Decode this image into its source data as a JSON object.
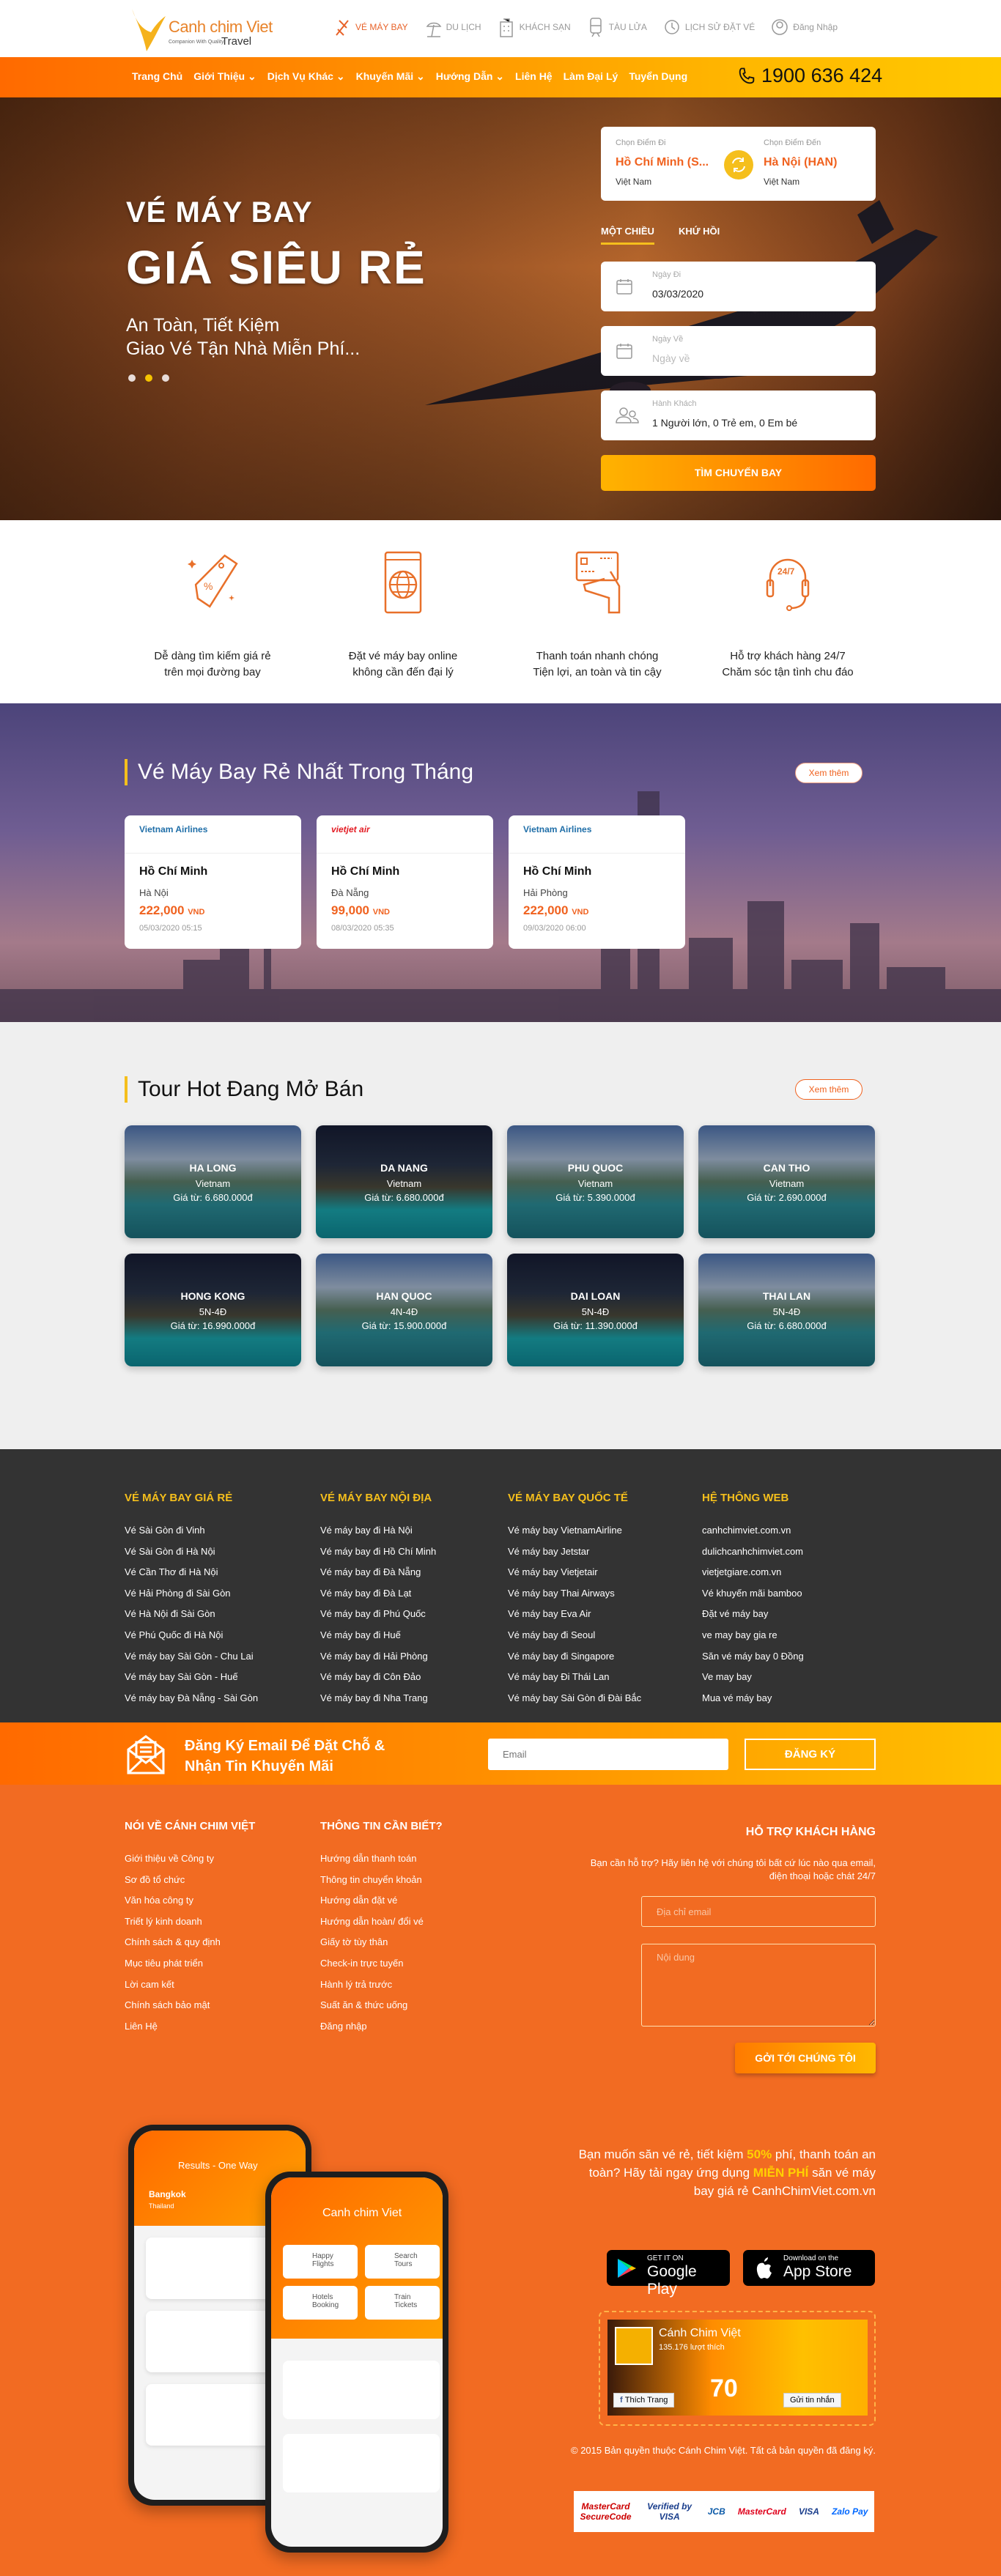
{
  "colors": {
    "accent": "#f0621f",
    "yellow": "#f5bf1c",
    "dark_footer": "#333333",
    "orange_footer": "#f26b22"
  },
  "header": {
    "logo": {
      "brand": "Canh chim Viet",
      "tagline": "Companion With Quality",
      "travel": "Travel"
    },
    "topnav": [
      {
        "label": "VÉ MÁY BAY",
        "icon": "plane-icon",
        "active": true
      },
      {
        "label": "DU LỊCH",
        "icon": "beach-umbrella-icon"
      },
      {
        "label": "KHÁCH SẠN",
        "icon": "hotel-icon"
      },
      {
        "label": "TÀU LỬA",
        "icon": "train-icon"
      },
      {
        "label": "LỊCH SỬ ĐẶT VÉ",
        "icon": "history-icon"
      },
      {
        "label": "Đăng Nhập",
        "icon": "user-icon"
      }
    ]
  },
  "nav": {
    "items": [
      {
        "label": "Trang Chủ"
      },
      {
        "label": "Giới Thiệu ⌄"
      },
      {
        "label": "Dịch Vụ Khác ⌄"
      },
      {
        "label": "Khuyến Mãi ⌄"
      },
      {
        "label": "Hướng Dẫn ⌄"
      },
      {
        "label": "Liên Hệ"
      },
      {
        "label": "Làm Đại Lý"
      },
      {
        "label": "Tuyển Dụng"
      }
    ],
    "hotline": "1900 636 424"
  },
  "hero": {
    "line1": "VÉ MÁY BAY",
    "line2": "GIÁ SIÊU RẺ",
    "sub1": "An Toàn, Tiết Kiệm",
    "sub2": "Giao Vé Tận Nhà Miễn Phí...",
    "slides": 3,
    "active_slide": 2
  },
  "search": {
    "from_label": "Chọn Điểm Đi",
    "from_city": "Hồ Chí Minh (S...",
    "from_country": "Việt Nam",
    "to_label": "Chọn Điểm Đến",
    "to_city": "Hà Nội (HAN)",
    "to_country": "Việt Nam",
    "tab_oneway": "MỘT CHIỀU",
    "tab_return": "KHỨ HỒI",
    "depart_label": "Ngày Đi",
    "depart_value": "03/03/2020",
    "return_label": "Ngày Về",
    "return_placeholder": "Ngày về",
    "pax_label": "Hành Khách",
    "pax_value": "1 Người lớn, 0 Trẻ em, 0 Em bé",
    "submit": "TÌM CHUYẾN BAY"
  },
  "features": [
    {
      "icon": "price-tag-icon",
      "l1": "Dễ dàng tìm kiếm giá rẻ",
      "l2": "trên mọi đường bay"
    },
    {
      "icon": "globe-browser-icon",
      "l1": "Đặt vé máy bay online",
      "l2": "không cần đến đại lý"
    },
    {
      "icon": "card-payment-icon",
      "l1": "Thanh toán nhanh chóng",
      "l2": "Tiện lợi, an toàn và tin cậy"
    },
    {
      "icon": "headset-247-icon",
      "l1": "Hỗ trợ khách hàng 24/7",
      "l2": "Chăm sóc tận tình chu đáo",
      "badge": "24/7"
    }
  ],
  "cheap": {
    "title": "Vé Máy Bay Rẻ Nhất Trong Tháng",
    "more": "Xem thêm",
    "flights": [
      {
        "airline": "Vietnam Airlines",
        "from": "Hồ Chí Minh",
        "to": "Hà Nội",
        "price": "222,000",
        "currency": "VND",
        "date": "05/03/2020 05:15"
      },
      {
        "airline": "vietjet air",
        "from": "Hồ Chí Minh",
        "to": "Đà Nẵng",
        "price": "99,000",
        "currency": "VND",
        "date": "08/03/2020 05:35"
      },
      {
        "airline": "Vietnam Airlines",
        "from": "Hồ Chí Minh",
        "to": "Hải Phòng",
        "price": "222,000",
        "currency": "VND",
        "date": "09/03/2020 06:00"
      }
    ]
  },
  "tours": {
    "title": "Tour Hot Đang Mở Bán",
    "more": "Xem thêm",
    "items": [
      {
        "name": "HA LONG",
        "sub": "Vietnam",
        "price": "Giá từ: 6.680.000đ",
        "bg": "lake"
      },
      {
        "name": "DA NANG",
        "sub": "Vietnam",
        "price": "Giá từ: 6.680.000đ",
        "bg": "pool"
      },
      {
        "name": "PHU QUOC",
        "sub": "Vietnam",
        "price": "Giá từ: 5.390.000đ",
        "bg": "lake"
      },
      {
        "name": "CAN THO",
        "sub": "Vietnam",
        "price": "Giá từ: 2.690.000đ",
        "bg": "lake"
      },
      {
        "name": "HONG KONG",
        "sub": "5N-4Đ",
        "price": "Giá từ: 16.990.000đ",
        "bg": "pool"
      },
      {
        "name": "HAN QUOC",
        "sub": "4N-4Đ",
        "price": "Giá từ: 15.900.000đ",
        "bg": "lake"
      },
      {
        "name": "DAI LOAN",
        "sub": "5N-4Đ",
        "price": "Giá từ: 11.390.000đ",
        "bg": "pool"
      },
      {
        "name": "THAI LAN",
        "sub": "5N-4Đ",
        "price": "Giá từ: 6.680.000đ",
        "bg": "lake"
      }
    ]
  },
  "dark_footer": [
    {
      "title": "VÉ MÁY BAY GIÁ RẺ",
      "links": [
        "Vé Sài Gòn đi Vinh",
        "Vé Sài Gòn đi Hà Nội",
        "Vé Cần Thơ đi Hà Nội",
        "Vé Hải Phòng đi Sài Gòn",
        "Vé Hà Nội đi Sài Gòn",
        "Vé Phú Quốc đi Hà Nội",
        "Vé máy bay Sài Gòn - Chu Lai",
        "Vé máy bay Sài Gòn - Huế",
        "Vé máy bay Đà Nẵng - Sài Gòn"
      ]
    },
    {
      "title": "VÉ MÁY BAY NỘI ĐỊA",
      "links": [
        "Vé máy bay đi Hà Nội",
        "Vé máy bay đi Hồ Chí Minh",
        "Vé máy bay đi Đà Nẵng",
        "Vé máy bay đi Đà Lạt",
        "Vé máy bay đi Phú Quốc",
        "Vé máy bay đi Huế",
        "Vé máy bay đi Hải Phòng",
        "Vé máy bay đi Côn Đảo",
        "Vé máy bay đi Nha Trang"
      ]
    },
    {
      "title": "VÉ MÁY BAY QUỐC TẾ",
      "links": [
        "Vé máy bay VietnamAirline",
        "Vé máy bay Jetstar",
        "Vé máy bay Vietjetair",
        "Vé máy bay Thai Airways",
        "Vé máy bay Eva Air",
        "Vé máy bay đi Seoul",
        "Vé máy bay đi Singapore",
        "Vé máy bay Đi Thái Lan",
        "Vé máy bay Sài Gòn đi Đài Bắc"
      ]
    },
    {
      "title": "HỆ THÔNG WEB",
      "links": [
        "canhchimviet.com.vn",
        "dulichcanhchimviet.com",
        "vietjetgiare.com.vn",
        "Vé khuyến mãi bamboo",
        "Đặt vé máy bay",
        "ve may bay gia re",
        "Săn vé máy bay 0 Đồng",
        "Ve may bay",
        "Mua vé máy bay"
      ]
    }
  ],
  "newsletter": {
    "title1": "Đăng Ký Email Để Đặt Chỗ &",
    "title2": "Nhận Tin Khuyến Mãi",
    "placeholder": "Email",
    "submit": "ĐĂNG KÝ"
  },
  "orange_footer": {
    "cols": [
      {
        "title": "NÓI VỀ CÁNH CHIM VIỆT",
        "links": [
          "Giới thiệu về Công ty",
          "Sơ đồ tổ chức",
          "Văn hóa công ty",
          "Triết lý kinh doanh",
          "Chính sách & quy định",
          "Mục tiêu phát triển",
          "Lời cam kết",
          "Chính sách bảo mật",
          "Liên Hệ"
        ]
      },
      {
        "title": "THÔNG TIN CẦN BIẾT?",
        "links": [
          "Hướng dẫn thanh toán",
          "Thông tin chuyển khoản",
          "Hướng dẫn đặt vé",
          "Hướng dẫn hoàn/ đổi vé",
          "Giấy tờ tùy thân",
          "Check-in trực tuyến",
          "Hành lý trả trước",
          "Suất ăn & thức uống",
          "Đăng nhập"
        ]
      }
    ],
    "support": {
      "title": "HỖ TRỢ KHÁCH HÀNG",
      "text": "Bạn cần hỗ trợ? Hãy liên hệ với chúng tôi bất cứ lúc nào qua email, điện thoại hoặc chát 24/7",
      "email_placeholder": "Địa chỉ email",
      "content_placeholder": "Nội dung",
      "submit": "GỞI TỚI CHÚNG TÔI"
    },
    "app": {
      "t1": "Bạn muốn săn vé rẻ, tiết kiệm ",
      "hl1": "50%",
      "t2": " phí, thanh toán an toàn? Hãy tải ngay ứng dụng ",
      "hl2": "MIỄN PHÍ",
      "t3": " săn vé máy bay giá rẻ CanhChimViet.com.vn",
      "google_small": "GET IT ON",
      "google_big": "Google Play",
      "apple_small": "Download on the",
      "apple_big": "App Store"
    },
    "phones": {
      "left_title": "Results - One Way",
      "left_city": "Bangkok",
      "left_country": "Thailand",
      "right_brand": "Canh chim Viet",
      "tiles": [
        "Happy Flights",
        "Search Tours",
        "Hotels Booking",
        "Train Tickets"
      ]
    },
    "facebook": {
      "page": "Cánh Chim Việt",
      "likes": "135.176 lượt thích",
      "like_btn": "Thích Trang",
      "msg_btn": "Gửi tin nhắn",
      "promo": "70"
    },
    "copyright": "© 2015 Bản quyền thuộc Cánh Chim Việt. Tất cả bản quyền đã đăng ký.",
    "payments": [
      "MasterCard SecureCode",
      "Verified by VISA",
      "JCB",
      "MasterCard",
      "VISA",
      "Zalo Pay"
    ]
  }
}
